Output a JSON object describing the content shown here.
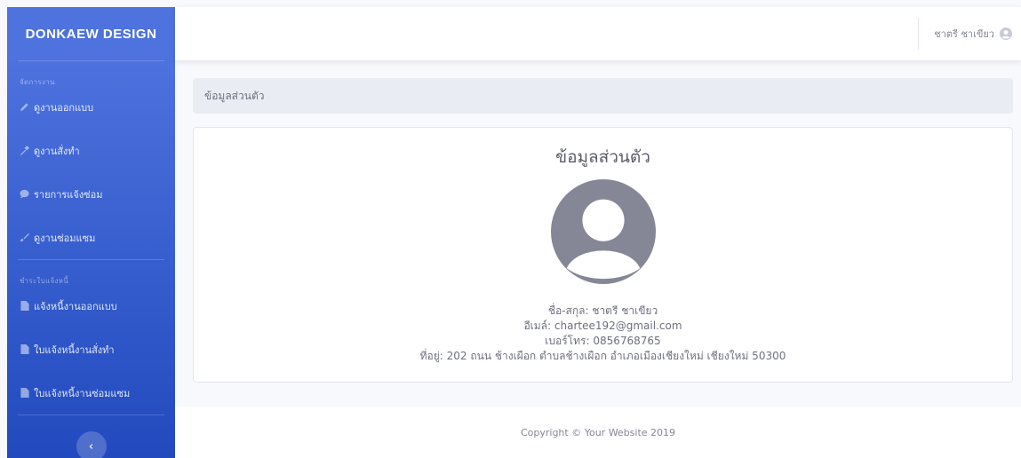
{
  "sidebar": {
    "brand": "DONKAEW DESIGN",
    "section1_heading": "จัดการงาน",
    "section1_items": [
      {
        "label": "ดูงานออกแบบ",
        "icon": "pencil-icon"
      },
      {
        "label": "ดูงานสั่งทำ",
        "icon": "hammer-icon"
      },
      {
        "label": "รายการแจ้งซ่อม",
        "icon": "comment-icon"
      },
      {
        "label": "ดูงานซ่อมแซม",
        "icon": "brush-icon"
      }
    ],
    "section2_heading": "ชำระใบแจ้งหนี้",
    "section2_items": [
      {
        "label": "แจ้งหนี้งานออกแบบ",
        "icon": "file-icon"
      },
      {
        "label": "ใบแจ้งหนี้งานสั่งทำ",
        "icon": "file-icon"
      },
      {
        "label": "ใบแจ้งหนี้งานซ่อมแซม",
        "icon": "file-icon"
      }
    ],
    "toggle_glyph": "‹"
  },
  "topbar": {
    "user_name": "ชาตรี ชาเขียว",
    "user_icon": "user-circle-icon"
  },
  "breadcrumb": "ข้อมูลส่วนตัว",
  "profile": {
    "title": "ข้อมูลส่วนตัว",
    "name_line": "ชื่อ-สกุล: ชาตรี ชาเขียว",
    "email_line": "อีเมล์: chartee192@gmail.com",
    "phone_line": "เบอร์โทร: 0856768765",
    "address_line": "ที่อยู่: 202 ถนน ช้างเผือก ตำบลช้างเผือก อำเภอเมืองเชียงใหม่ เชียงใหม่ 50300"
  },
  "footer": "Copyright © Your Website 2019",
  "colors": {
    "sidebar_top": "#4e73df",
    "sidebar_bottom": "#224abe",
    "avatar": "#858796"
  }
}
